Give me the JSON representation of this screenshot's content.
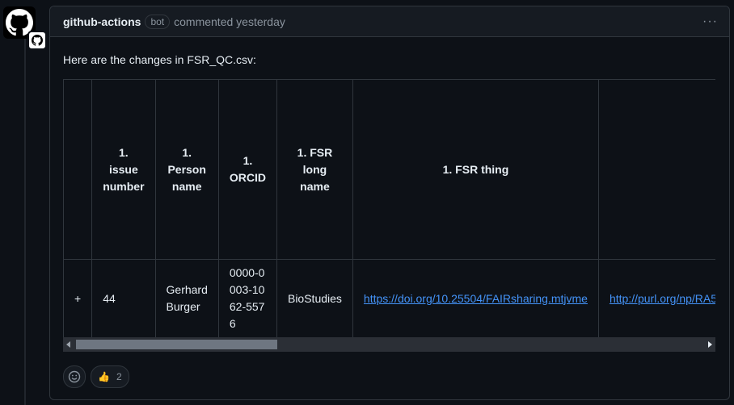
{
  "comment": {
    "author": "github-actions",
    "badge": "bot",
    "timestamp": "commented yesterday",
    "more_label": "···",
    "intro": "Here are the changes in FSR_QC.csv:"
  },
  "table": {
    "headers": [
      "",
      "1. issue number",
      "1. Person name",
      "1. ORCID",
      "1. FSR long name",
      "1. FSR thing",
      ""
    ],
    "rows": [
      {
        "marker": "+",
        "issue_number": "44",
        "person_name": "Gerhard Burger",
        "orcid": "0000-0003-1062-5576",
        "fsr_long_name": "BioStudies",
        "fsr_thing": "https://doi.org/10.25504/FAIRsharing.mtjvme",
        "next_cell": "http://purl.org/np/RA5"
      }
    ]
  },
  "reactions": {
    "thumbs_up_emoji": "👍",
    "thumbs_up_count": "2"
  },
  "colors": {
    "background": "#0d1117",
    "header_bg": "#161b22",
    "border": "#30363d",
    "link": "#4493f8",
    "muted": "#8b949e"
  }
}
